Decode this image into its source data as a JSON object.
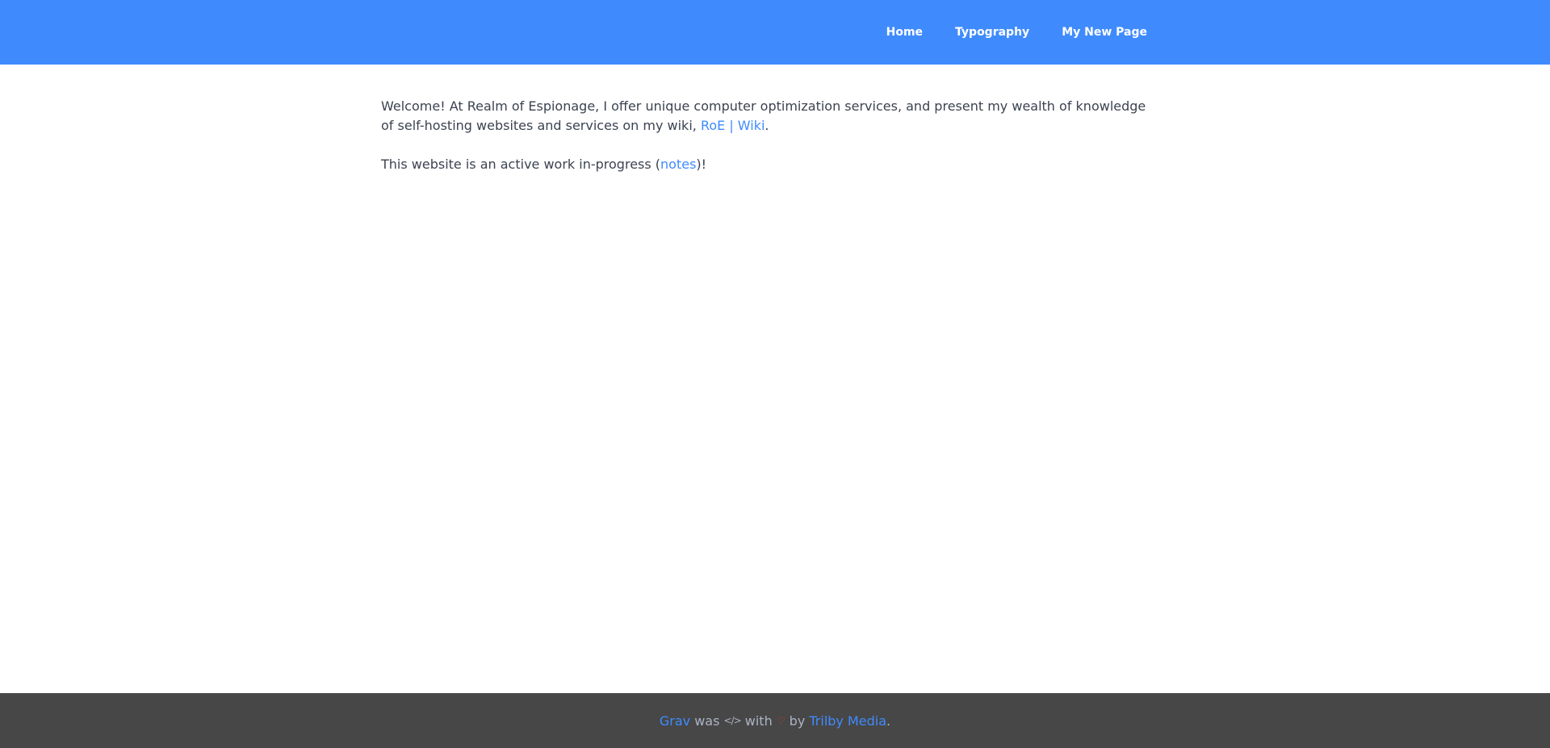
{
  "header": {
    "nav": {
      "items": [
        {
          "label": "Home"
        },
        {
          "label": "Typography"
        },
        {
          "label": "My New Page"
        }
      ]
    }
  },
  "content": {
    "p1": {
      "before": "Welcome! At Realm of Espionage, I offer unique computer optimization services, and present my wealth of knowledge of self-hosting websites and services on my wiki, ",
      "link": "RoE | Wiki",
      "after": "."
    },
    "p2": {
      "before": "This website is an active work in-progress (",
      "link": "notes",
      "after": ")!"
    }
  },
  "footer": {
    "grav": "Grav",
    "was": " was ",
    "with": " with ",
    "by": " by ",
    "trilby": "Trilby Media",
    "period": ".",
    "icons": {
      "code": "code-icon",
      "heart": "heart-icon"
    }
  },
  "colors": {
    "header_bg": "#3f8bfe",
    "footer_bg": "#474747",
    "link": "#3f8bfe",
    "text": "#3b4351",
    "heart": "#d13a2b"
  }
}
